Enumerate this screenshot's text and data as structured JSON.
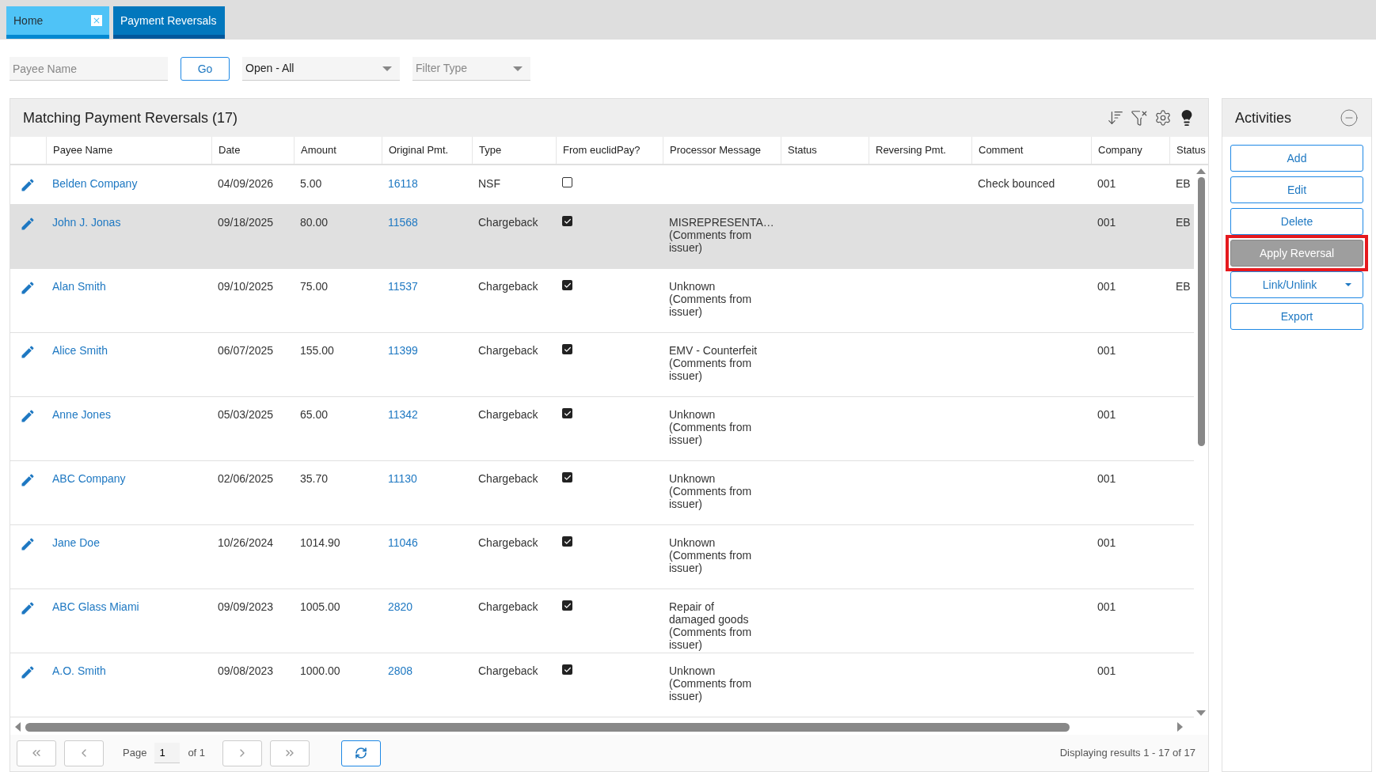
{
  "tabs": [
    {
      "label": "Home",
      "selected": false,
      "closable": true
    },
    {
      "label": "Payment Reversals",
      "selected": true,
      "closable": false
    }
  ],
  "filters": {
    "payee_field": {
      "placeholder": "Payee Name"
    },
    "go_button": "Go",
    "status_select": {
      "value": "Open - All"
    },
    "type_select": {
      "placeholder": "Filter Type"
    }
  },
  "grid": {
    "title": "Matching Payment Reversals (17)",
    "columns": [
      "Payee Name",
      "Date",
      "Amount",
      "Original Pmt.",
      "Type",
      "From euclidPay?",
      "Processor Message",
      "Status",
      "Reversing Pmt.",
      "Comment",
      "Company",
      "Status"
    ],
    "rows": [
      {
        "payee": "Belden Company",
        "date": "04/09/2026",
        "amount": "5.00",
        "original_pmt": "16118",
        "type": "NSF",
        "from_euclidpay": false,
        "comment": "Check bounced",
        "company": "001",
        "status_2": "EB",
        "selected": false
      },
      {
        "payee": "John J. Jonas",
        "date": "09/18/2025",
        "amount": "80.00",
        "original_pmt": "11568",
        "type": "Chargeback",
        "from_euclidpay": true,
        "processor_message": "MISREPRESENTA… (Comments from issuer)",
        "company": "001",
        "status_2": "EB",
        "selected": true
      },
      {
        "payee": "Alan Smith",
        "date": "09/10/2025",
        "amount": "75.00",
        "original_pmt": "11537",
        "type": "Chargeback",
        "from_euclidpay": true,
        "processor_message": "Unknown (Comments from issuer)",
        "company": "001",
        "status_2": "EB",
        "selected": false
      },
      {
        "payee": "Alice Smith",
        "date": "06/07/2025",
        "amount": "155.00",
        "original_pmt": "11399",
        "type": "Chargeback",
        "from_euclidpay": true,
        "processor_message": "EMV - Counterfeit (Comments from issuer)",
        "company": "001",
        "selected": false
      },
      {
        "payee": "Anne Jones",
        "date": "05/03/2025",
        "amount": "65.00",
        "original_pmt": "11342",
        "type": "Chargeback",
        "from_euclidpay": true,
        "processor_message": "Unknown (Comments from issuer)",
        "company": "001",
        "selected": false
      },
      {
        "payee": "ABC Company",
        "date": "02/06/2025",
        "amount": "35.70",
        "original_pmt": "11130",
        "type": "Chargeback",
        "from_euclidpay": true,
        "processor_message": "Unknown (Comments from issuer)",
        "company": "001",
        "selected": false
      },
      {
        "payee": "Jane Doe",
        "date": "10/26/2024",
        "amount": "1014.90",
        "original_pmt": "11046",
        "type": "Chargeback",
        "from_euclidpay": true,
        "processor_message": "Unknown (Comments from issuer)",
        "company": "001",
        "selected": false
      },
      {
        "payee": "ABC Glass Miami",
        "date": "09/09/2023",
        "amount": "1005.00",
        "original_pmt": "2820",
        "type": "Chargeback",
        "from_euclidpay": true,
        "processor_message": "Repair of damaged goods (Comments from issuer)",
        "company": "001",
        "selected": false
      },
      {
        "payee": "A.O. Smith",
        "date": "09/08/2023",
        "amount": "1000.00",
        "original_pmt": "2808",
        "type": "Chargeback",
        "from_euclidpay": true,
        "processor_message": "Unknown (Comments from issuer)",
        "company": "001",
        "selected": false
      }
    ]
  },
  "pagination": {
    "page_label": "Page",
    "page_value": "1",
    "of_label": "of 1",
    "summary": "Displaying results 1 - 17 of 17"
  },
  "activities": {
    "title": "Activities",
    "buttons": [
      {
        "label": "Add",
        "kind": "outline",
        "highlighted": false
      },
      {
        "label": "Edit",
        "kind": "outline",
        "highlighted": false
      },
      {
        "label": "Delete",
        "kind": "outline",
        "highlighted": false
      },
      {
        "label": "Apply Reversal",
        "kind": "filled",
        "highlighted": true
      },
      {
        "label": "Link/Unlink",
        "kind": "dropdown",
        "highlighted": false
      },
      {
        "label": "Export",
        "kind": "outline",
        "highlighted": false
      }
    ]
  }
}
